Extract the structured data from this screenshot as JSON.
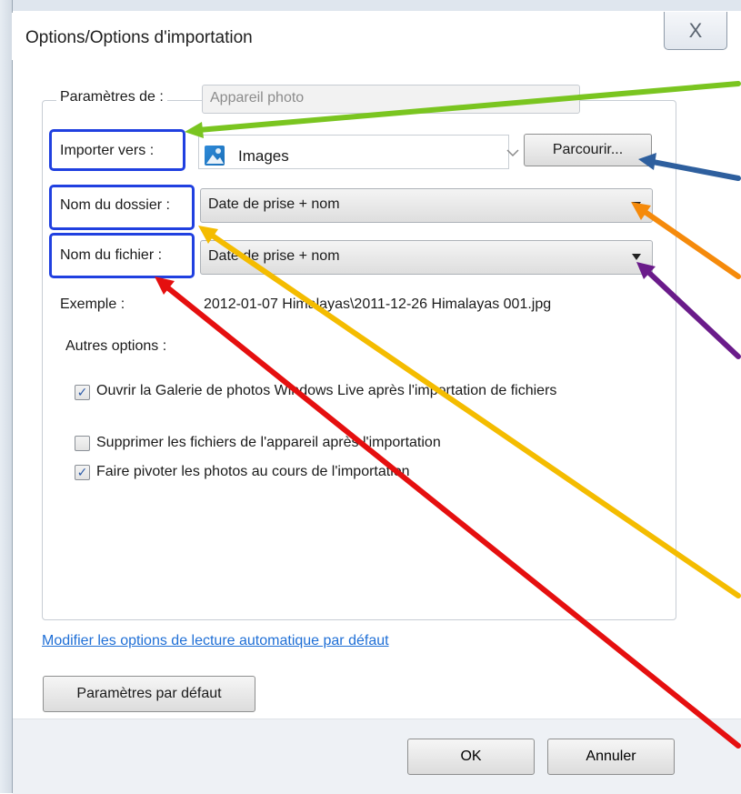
{
  "window": {
    "title": "Options/Options d'importation",
    "close_glyph": "X"
  },
  "settings_for": {
    "label": "Paramètres de :",
    "value": "Appareil photo"
  },
  "import_to": {
    "label": "Importer vers :",
    "folder_name": "Images",
    "browse_label": "Parcourir..."
  },
  "folder_name": {
    "label": "Nom du dossier :",
    "value": "Date de prise + nom"
  },
  "file_name": {
    "label": "Nom du fichier :",
    "value": "Date de prise + nom"
  },
  "example": {
    "label": "Exemple :",
    "value": "2012-01-07 Himalayas\\2011-12-26 Himalayas 001.jpg"
  },
  "other_options": {
    "label": "Autres options :",
    "items": [
      {
        "label": "Ouvrir la Galerie de photos Windows Live après l'importation de fichiers",
        "checked": true
      },
      {
        "label": "Supprimer les fichiers de l'appareil après l'importation",
        "checked": false
      },
      {
        "label": "Faire pivoter les photos au cours de l'importation",
        "checked": true
      }
    ]
  },
  "autoplay_link": "Modifier les options de lecture automatique par défaut",
  "defaults_button": "Paramètres par défaut",
  "ok_button": "OK",
  "cancel_button": "Annuler",
  "annotation_colors": {
    "highlight_box": "#2040e0",
    "arrow_green": "#7ac520",
    "arrow_blue": "#2e5f9e",
    "arrow_orange": "#f58a0b",
    "arrow_purple": "#6a1b8a",
    "arrow_yellow": "#f4bc00",
    "arrow_red": "#e50f0f"
  },
  "icons": {
    "close": "close-icon",
    "images_folder": "images-folder-icon",
    "dropdown": "chevron-down-icon",
    "checkbox_check": "checkmark-icon"
  }
}
